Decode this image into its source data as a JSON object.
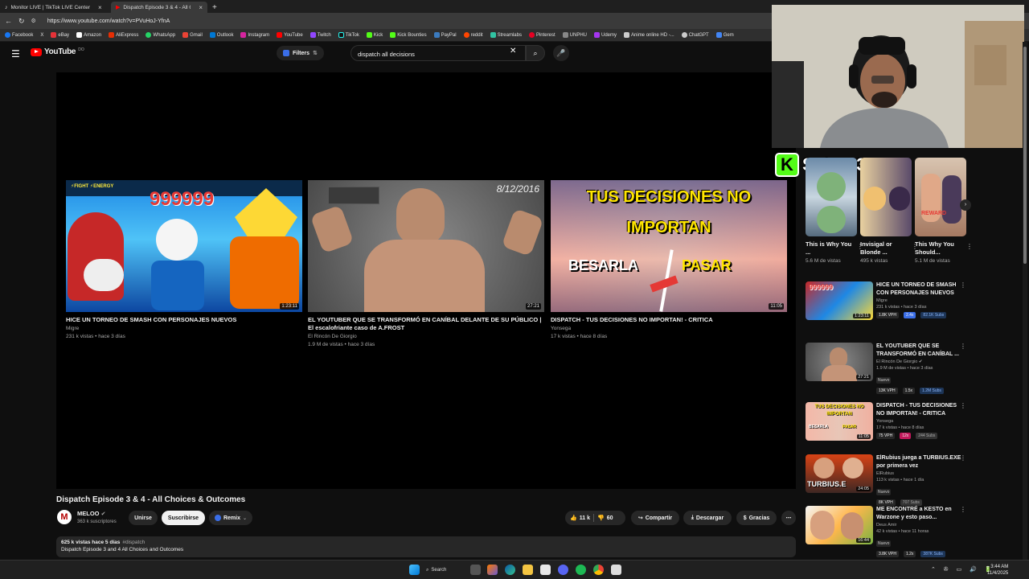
{
  "browser": {
    "tabs": [
      {
        "label": "Monitor LIVE | TikTok LIVE Center",
        "active": false
      },
      {
        "label": "Dispatch Episode 3 & 4 - All Ch...",
        "active": true
      }
    ],
    "url": "https://www.youtube.com/watch?v=PVuHoJ-YfnA",
    "bookmarks": [
      "Facebook",
      "X",
      "eBay",
      "Amazon",
      "AliExpress",
      "WhatsApp",
      "Gmail",
      "Outlook",
      "Instagram",
      "YouTube",
      "Twitch",
      "TikTok",
      "Kick",
      "Kick Bounties",
      "PayPal",
      "reddit",
      "Streamlabs",
      "Pinterest",
      "UNPHU",
      "Udemy",
      "Anime online HD -...",
      "ChatGPT",
      "Gem"
    ]
  },
  "header": {
    "logo_text": "YouTube",
    "logo_region": "DO",
    "filters_label": "Filters",
    "search_value": "dispatch all decisions"
  },
  "endcards": [
    {
      "title": "HICE UN TORNEO DE SMASH CON PERSONAJES NUEVOS",
      "channel": "Migre",
      "meta": "231 k vistas • hace 3 días",
      "duration": "1:23:11",
      "thumb_text": "999999"
    },
    {
      "title": "EL YOUTUBER QUE SE TRANSFORMÓ EN CANÍBAL DELANTE DE SU PÚBLICO | El escalofriante caso de A.FROST",
      "channel": "El Rincón De Giorgio",
      "meta": "1.9 M de vistas • hace 3 días",
      "duration": "27:21",
      "thumb_text": "8/12/2016"
    },
    {
      "title": "DISPATCH - TUS DECISIONES NO IMPORTAN! - CRITICA",
      "channel": "Yonsega",
      "meta": "17 k vistas • hace 8 días",
      "duration": "11:05",
      "thumb_line1": "TUS DECISIONES NO",
      "thumb_line2": "IMPORTAN",
      "thumb_left": "BESARLA",
      "thumb_right": "PASAR"
    }
  ],
  "video": {
    "title": "Dispatch Episode 3 & 4 - All Choices & Outcomes",
    "channel": "MELOO",
    "avatar_letter": "M",
    "subscribers": "363 k suscriptores",
    "join_label": "Unirse",
    "subscribe_label": "Suscribirse",
    "remix_label": "Remix",
    "likes": "11 k",
    "dislikes": "60",
    "share_label": "Compartir",
    "download_label": "Descargar",
    "thanks_label": "Gracias",
    "views_line": "625 k vistas  hace 5 días",
    "hashtag": "#dispatch",
    "description": "Dispatch Episode 3 and 4 All Choices and Outcomes"
  },
  "overlay": {
    "kick_letter": "K",
    "subs_text": "Subs: 3"
  },
  "shorts": [
    {
      "title": "This is Why You ...",
      "views": "5.6 M de vistas"
    },
    {
      "title": "Invisigal or Blonde ...",
      "views": "495 k vistas"
    },
    {
      "title": "This Why You Should...",
      "views": "5.1 M de vistas"
    }
  ],
  "recommendations": [
    {
      "title": "HICE UN TORNEO DE SMASH CON PERSONAJES NUEVOS",
      "channel": "Migre",
      "meta": "231 k vistas • hace 3 días",
      "duration": "1:23:11",
      "isnew": "",
      "stats": [
        "1.8K VPH",
        "2.4x",
        "82.1K Subs"
      ],
      "stat_colors": [
        "#272727",
        "#3a6ee8",
        "#1d3557"
      ]
    },
    {
      "title": "EL YOUTUBER QUE SE TRANSFORMÓ EN CANÍBAL ...",
      "channel": "El Rincón De Giorgio",
      "meta": "1.9 M de vistas • hace 3 días",
      "duration": "27:21",
      "isnew": "Nuevo",
      "stats": [
        "13K VPH",
        "1.5x",
        "1.2M Subs"
      ],
      "stat_colors": [
        "#272727",
        "#272727",
        "#1d3557"
      ]
    },
    {
      "title": "DISPATCH - TUS DECISIONES NO IMPORTAN! - CRITICA",
      "channel": "Yonsega",
      "meta": "17 k vistas • hace 8 días",
      "duration": "11:05",
      "isnew": "",
      "stats": [
        "75 VPH",
        "12x",
        "244 Subs"
      ],
      "stat_colors": [
        "#272727",
        "#c2185b",
        "#333"
      ]
    },
    {
      "title": "ElRubius juega a TURBIUS.EXE por primera vez",
      "channel": "ElRubius",
      "meta": "113 k vistas • hace 1 día",
      "duration": "24:05",
      "isnew": "Nuevo",
      "stats": [
        "8K VPH",
        "707 Subs"
      ],
      "stat_colors": [
        "#272727",
        "#333"
      ]
    },
    {
      "title": "ME ENCONTRÉ a KESTO en Warzone y esto paso...",
      "channel": "Deus Amir",
      "meta": "42 k vistas • hace 11 horas",
      "duration": "16:44",
      "isnew": "Nuevo",
      "stats": [
        "3.8K VPH",
        "1.2x",
        "387K Subs"
      ],
      "stat_colors": [
        "#272727",
        "#272727",
        "#1d3557"
      ]
    }
  ],
  "taskbar": {
    "search_label": "Search",
    "time": "3:44 AM",
    "date": "11/4/2025"
  }
}
